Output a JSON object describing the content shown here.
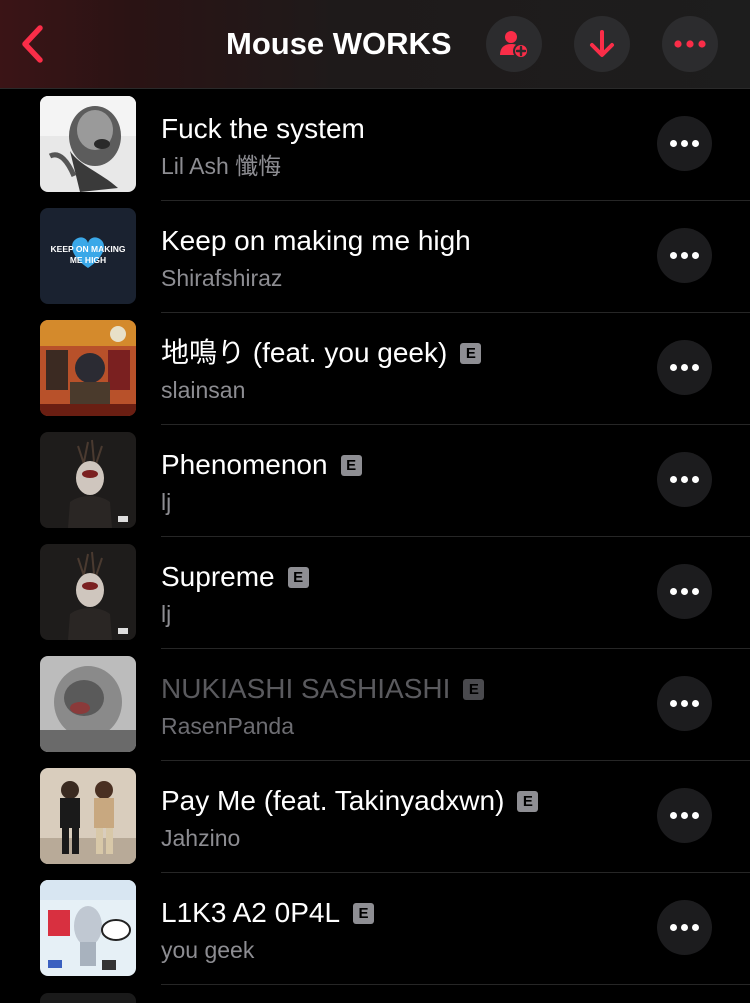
{
  "header": {
    "title": "Mouse WORKS",
    "back_icon": "chevron-left-icon",
    "actions": [
      "add-user-icon",
      "download-arrow-icon",
      "more-icon"
    ],
    "accent_color": "#fa2d48"
  },
  "tracks": [
    {
      "title": "Fuck the system",
      "artist": "Lil Ash 懺悔",
      "explicit": false,
      "dimmed": false
    },
    {
      "title": "Keep on making me high",
      "artist": "Shirafshiraz",
      "explicit": false,
      "dimmed": false,
      "artwork_text": [
        "KEEP ON MAKING",
        "ME HIGH"
      ]
    },
    {
      "title": "地鳴り (feat. you geek)",
      "artist": "slainsan",
      "explicit": true,
      "dimmed": false
    },
    {
      "title": "Phenomenon",
      "artist": "lj",
      "explicit": true,
      "dimmed": false
    },
    {
      "title": "Supreme",
      "artist": "lj",
      "explicit": true,
      "dimmed": false
    },
    {
      "title": "NUKIASHI SASHIASHI",
      "artist": "RasenPanda",
      "explicit": true,
      "dimmed": true
    },
    {
      "title": "Pay Me (feat. Takinyadxwn)",
      "artist": "Jahzino",
      "explicit": true,
      "dimmed": false
    },
    {
      "title": "L1K3 A2 0P4L",
      "artist": "you geek",
      "explicit": true,
      "dimmed": false
    }
  ],
  "explicit_badge": "E"
}
